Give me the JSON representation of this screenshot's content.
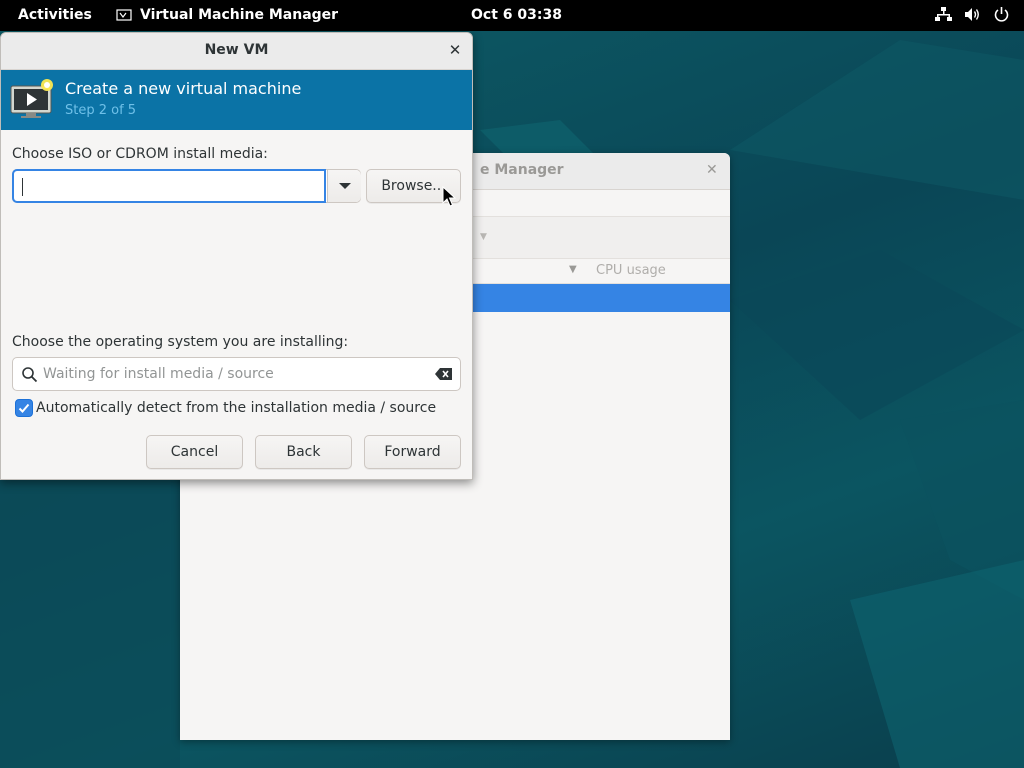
{
  "topbar": {
    "activities": "Activities",
    "app_name": "Virtual Machine Manager",
    "clock": "Oct 6  03:38",
    "tray_icons": [
      "network-wired-icon",
      "volume-icon",
      "power-icon"
    ]
  },
  "background_window": {
    "title_partial": "e Manager",
    "column_header": "CPU usage"
  },
  "dialog": {
    "title": "New VM",
    "banner": {
      "heading": "Create a new virtual machine",
      "step": "Step 2 of 5"
    },
    "iso_label": "Choose ISO or CDROM install media:",
    "iso_value": "",
    "browse_label": "Browse...",
    "os_label": "Choose the operating system you are installing:",
    "os_search_placeholder": "Waiting for install media / source",
    "auto_detect": {
      "label": "Automatically detect from the installation media / source",
      "checked": true
    },
    "buttons": {
      "cancel": "Cancel",
      "back": "Back",
      "forward": "Forward"
    }
  },
  "colors": {
    "accent": "#3584e4",
    "banner": "#0b73a6",
    "banner_step": "#6fc0e8",
    "topbar": "#000000"
  }
}
